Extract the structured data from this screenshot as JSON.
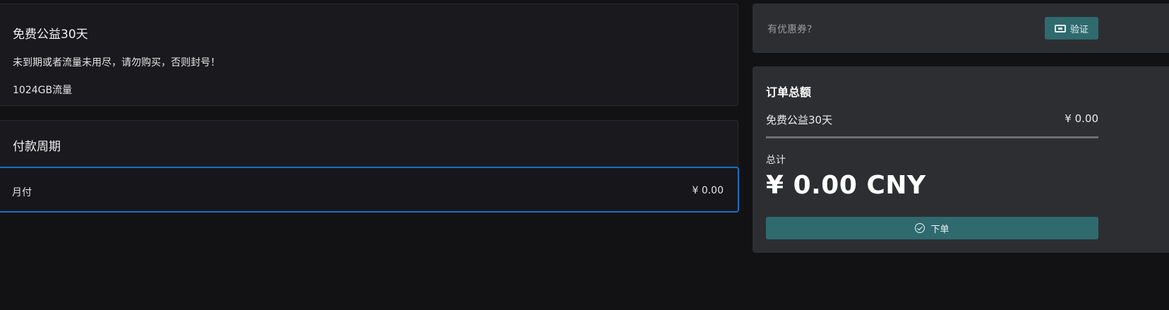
{
  "plan": {
    "title": "免费公益30天",
    "description": "未到期或者流量未用尽，请勿购买，否则封号！",
    "traffic": "1024GB流量"
  },
  "billing_period": {
    "title": "付款周期",
    "selected_option": {
      "label": "月付",
      "price": "¥ 0.00"
    }
  },
  "coupon": {
    "label": "有优惠券?",
    "verify_button": "验证"
  },
  "order_summary": {
    "title": "订单总额",
    "item_name": "免费公益30天",
    "item_price": "¥ 0.00",
    "total_label": "总计",
    "total_amount": "¥ 0.00 CNY",
    "submit_button": "下单"
  },
  "colors": {
    "accent_button": "#2f6a6e",
    "selected_border": "#1b6ec2"
  }
}
